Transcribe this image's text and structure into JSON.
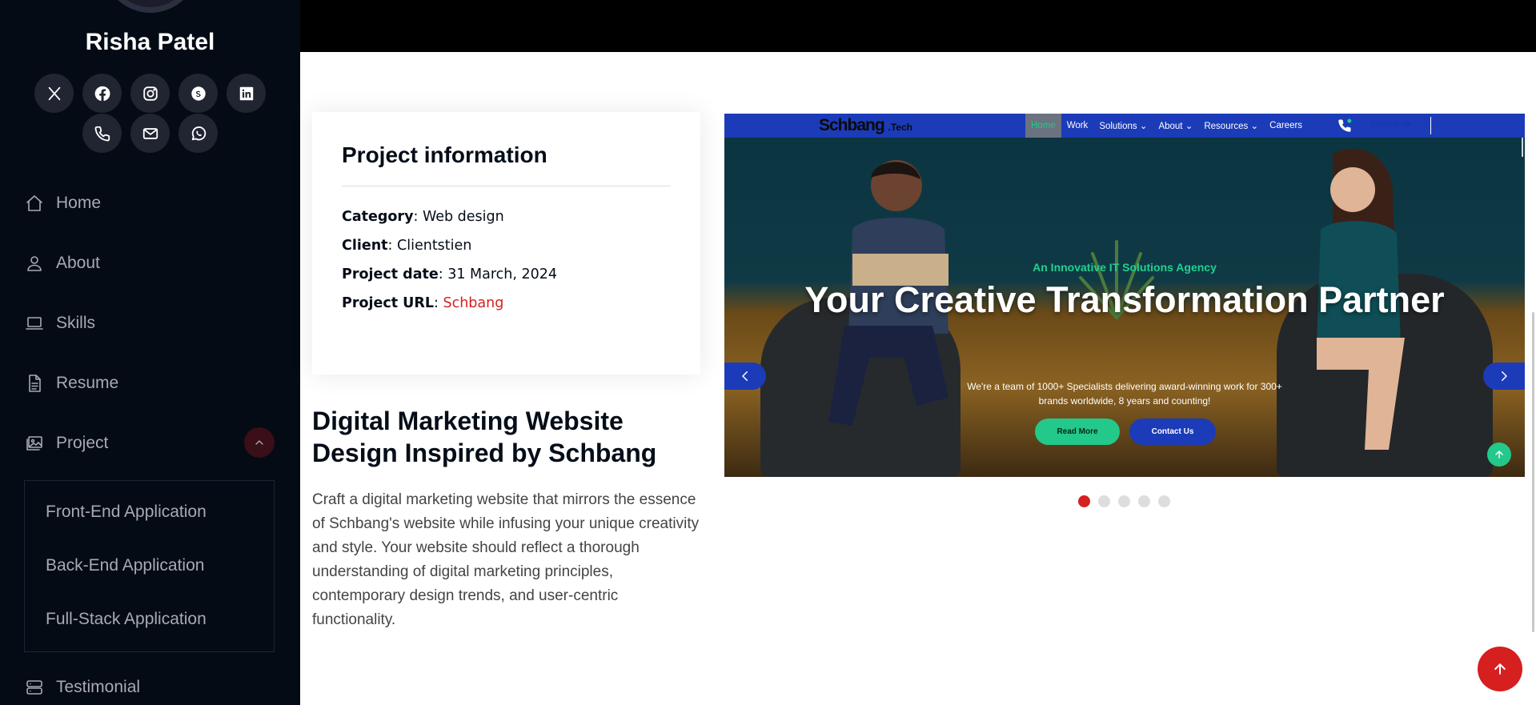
{
  "sidebar": {
    "name": "Risha Patel",
    "socials": [
      {
        "icon": "x-twitter-icon"
      },
      {
        "icon": "facebook-icon"
      },
      {
        "icon": "instagram-icon"
      },
      {
        "icon": "skype-icon"
      },
      {
        "icon": "linkedin-icon"
      },
      {
        "icon": "phone-icon"
      },
      {
        "icon": "envelope-icon"
      },
      {
        "icon": "whatsapp-icon"
      }
    ],
    "nav": {
      "home": "Home",
      "about": "About",
      "skills": "Skills",
      "resume": "Resume",
      "project": "Project",
      "testimonial": "Testimonial"
    },
    "project_submenu": {
      "frontend": "Front-End Application",
      "backend": "Back-End Application",
      "fullstack": "Full-Stack Application"
    }
  },
  "project_info": {
    "title": "Project information",
    "category_label": "Category",
    "category_value": "Web design",
    "client_label": "Client",
    "client_value": "Clientstien",
    "date_label": "Project date",
    "date_value": "31 March, 2024",
    "url_label": "Project URL",
    "url_value": "Schbang"
  },
  "project": {
    "heading": "Digital Marketing Website Design Inspired by Schbang",
    "description": "Craft a digital marketing website that mirrors the essence of Schbang's website while infusing your unique creativity and style. Your website should reflect a thorough understanding of digital marketing principles, contemporary design trends, and user-centric functionality."
  },
  "slide": {
    "logo": "Schbang",
    "logo_suffix": ".Tech",
    "menu": {
      "home": "Home",
      "work": "Work",
      "solutions": "Solutions ⌄",
      "about": "About ⌄",
      "resources": "Resources ⌄",
      "careers": "Careers"
    },
    "contact_top": "Contact Us",
    "tagline": "An Innovative IT Solutions Agency",
    "heading": "Your Creative Transformation Partner",
    "paragraph": "We're a team of 1000+ Specialists delivering award-winning work for 300+ brands worldwide, 8 years and counting!",
    "btn_read": "Read More",
    "btn_contact": "Contact Us"
  },
  "carousel": {
    "total_slides": 5,
    "active_index": 0
  },
  "colors": {
    "accent": "#d61f1f",
    "sidebar_bg": "#040b14",
    "slide_blue": "#1b3bb8",
    "slide_green": "#22c98a"
  }
}
